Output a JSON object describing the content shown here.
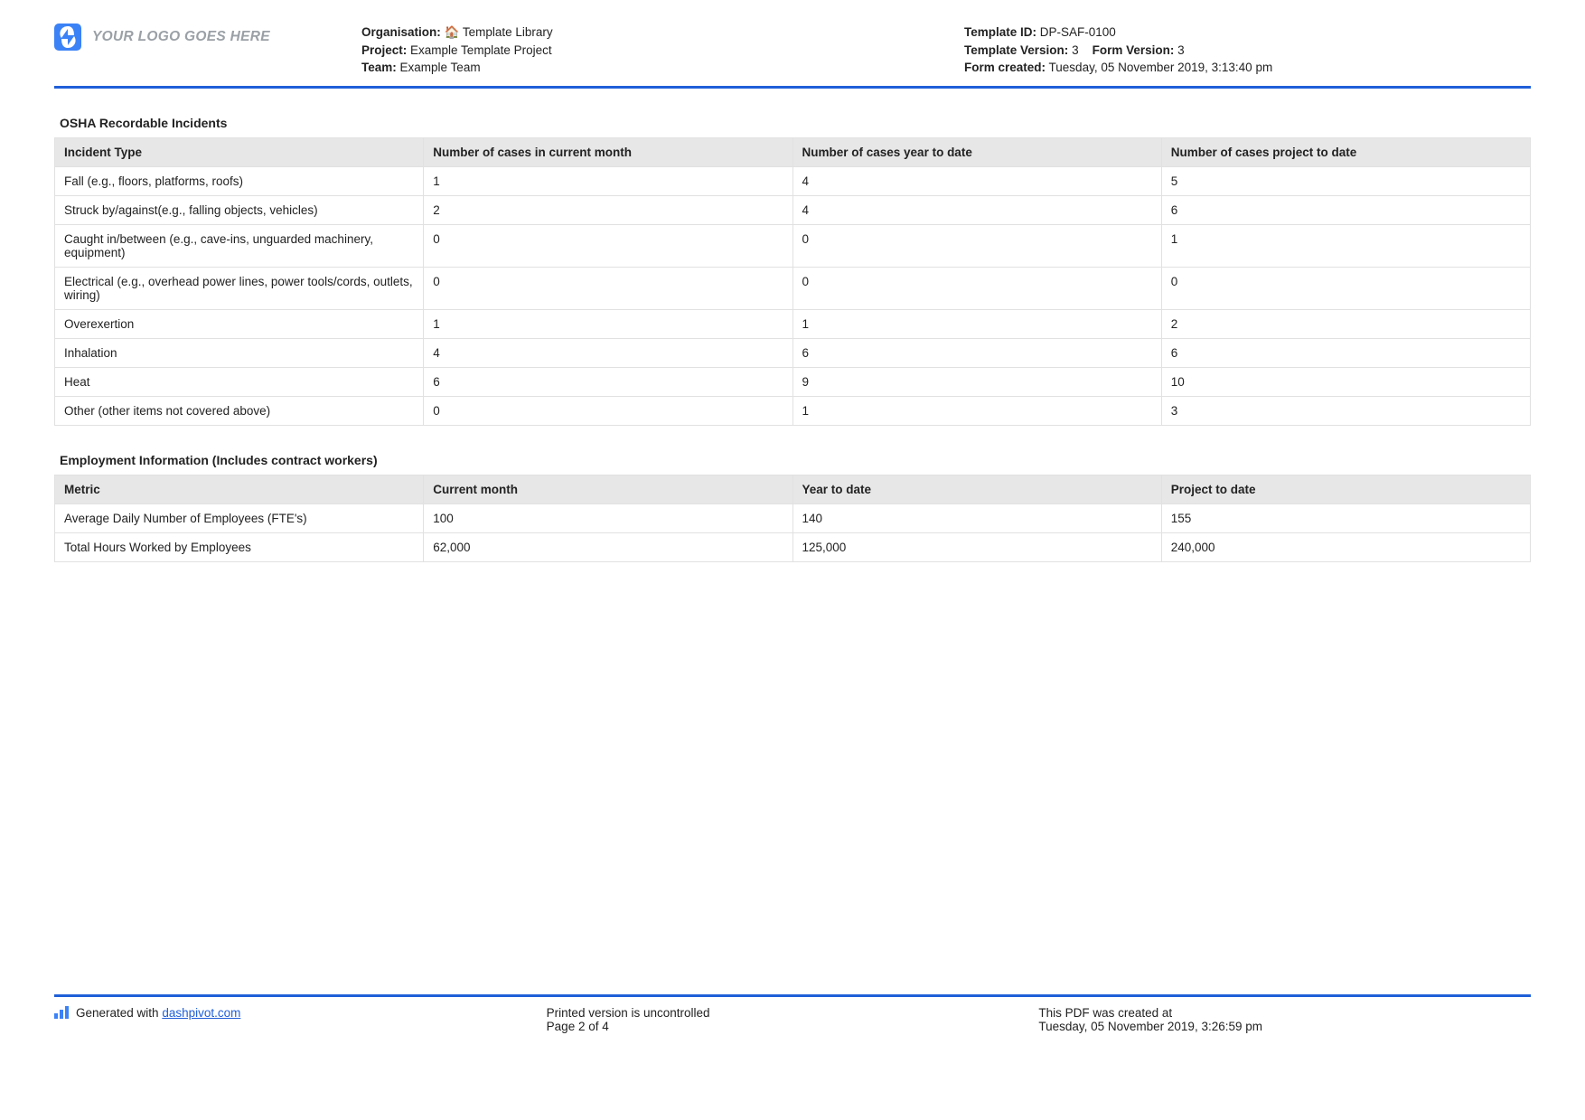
{
  "logo_placeholder": "YOUR LOGO GOES HERE",
  "header": {
    "left": {
      "organisation_label": "Organisation:",
      "organisation_value": "🏠 Template Library",
      "project_label": "Project:",
      "project_value": "Example Template Project",
      "team_label": "Team:",
      "team_value": "Example Team"
    },
    "right": {
      "template_id_label": "Template ID:",
      "template_id_value": "DP-SAF-0100",
      "template_version_label": "Template Version:",
      "template_version_value": "3",
      "form_version_label": "Form Version:",
      "form_version_value": "3",
      "form_created_label": "Form created:",
      "form_created_value": "Tuesday, 05 November 2019, 3:13:40 pm"
    }
  },
  "incidents": {
    "title": "OSHA Recordable Incidents",
    "headers": [
      "Incident Type",
      "Number of cases in current month",
      "Number of cases year to date",
      "Number of cases project to date"
    ],
    "rows": [
      {
        "type": "Fall (e.g., floors, platforms, roofs)",
        "m": "1",
        "y": "4",
        "p": "5"
      },
      {
        "type": "Struck by/against(e.g., falling objects, vehicles)",
        "m": "2",
        "y": "4",
        "p": "6"
      },
      {
        "type": "Caught in/between (e.g., cave-ins, unguarded machinery, equipment)",
        "m": "0",
        "y": "0",
        "p": "1"
      },
      {
        "type": "Electrical (e.g., overhead power lines, power tools/cords, outlets, wiring)",
        "m": "0",
        "y": "0",
        "p": "0"
      },
      {
        "type": "Overexertion",
        "m": "1",
        "y": "1",
        "p": "2"
      },
      {
        "type": "Inhalation",
        "m": "4",
        "y": "6",
        "p": "6"
      },
      {
        "type": "Heat",
        "m": "6",
        "y": "9",
        "p": "10"
      },
      {
        "type": "Other (other items not covered above)",
        "m": "0",
        "y": "1",
        "p": "3"
      }
    ]
  },
  "employment": {
    "title": "Employment Information (Includes contract workers)",
    "headers": [
      "Metric",
      "Current month",
      "Year to date",
      "Project to date"
    ],
    "rows": [
      {
        "metric": "Average Daily Number of Employees (FTE's)",
        "m": "100",
        "y": "140",
        "p": "155"
      },
      {
        "metric": "Total Hours Worked by Employees",
        "m": "62,000",
        "y": "125,000",
        "p": "240,000"
      }
    ]
  },
  "footer": {
    "generated_label": "Generated with ",
    "generated_link": "dashpivot.com",
    "center1": "Printed version is uncontrolled",
    "center2": "Page 2 of 4",
    "right1": "This PDF was created at",
    "right2": "Tuesday, 05 November 2019, 3:26:59 pm"
  }
}
